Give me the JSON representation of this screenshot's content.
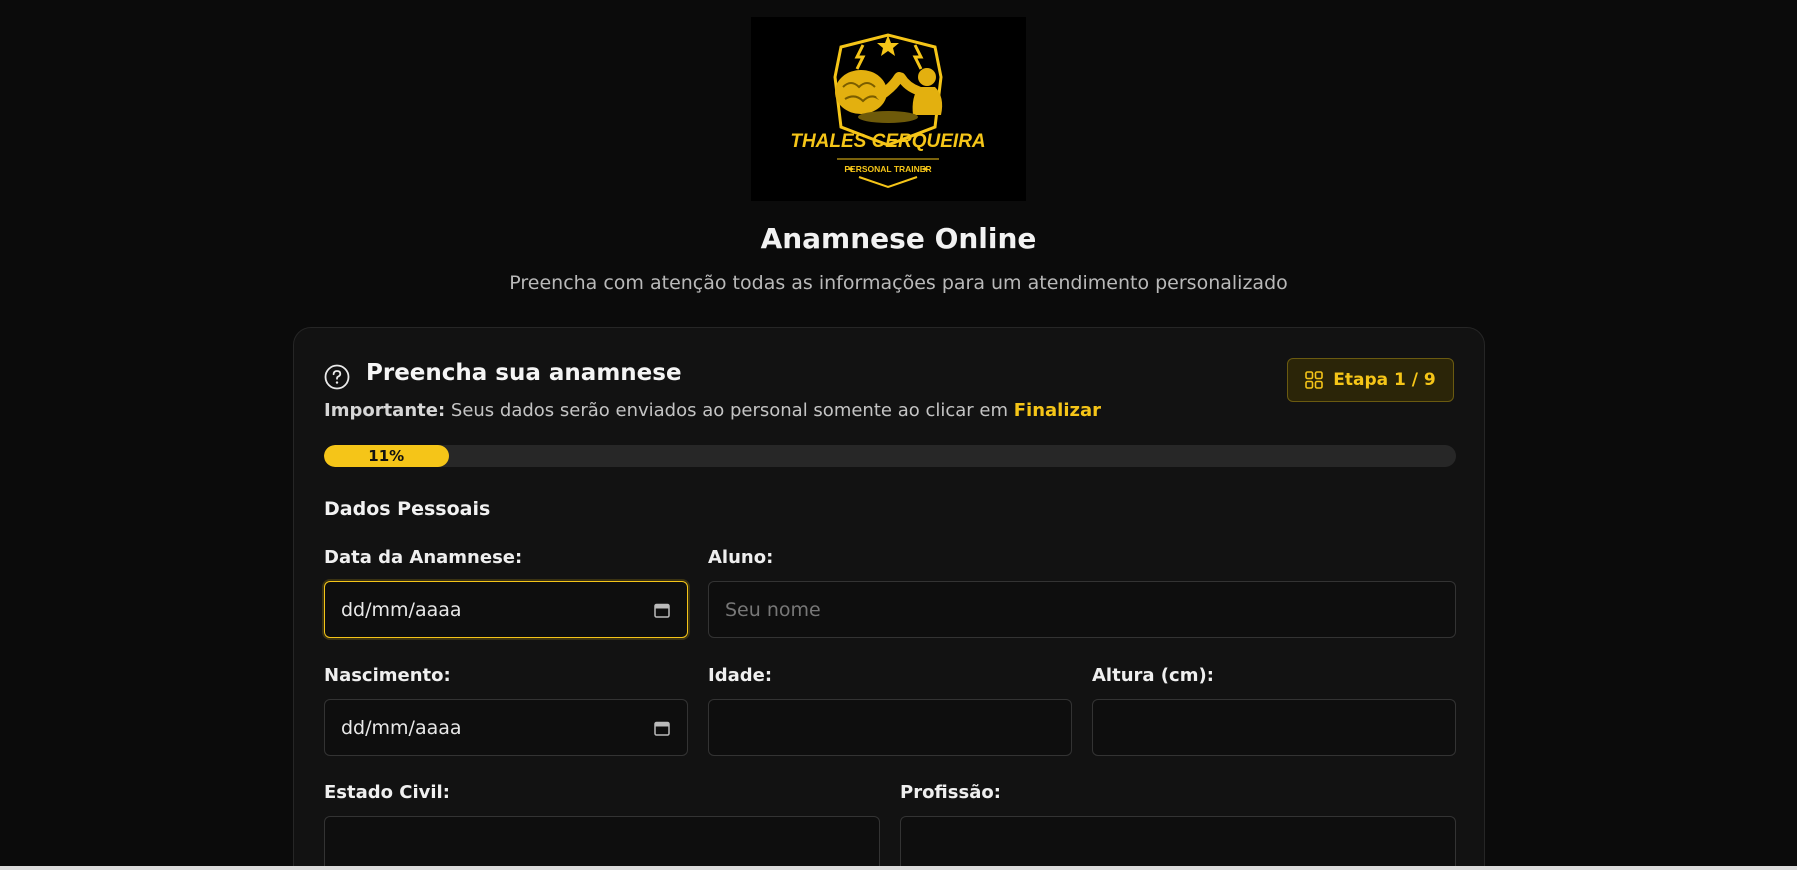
{
  "logo": {
    "brand_name": "THALES CERQUEIRA",
    "brand_tagline": "PERSONAL TRAINER",
    "accent_color": "#f5c518",
    "icon": "brain-armwrestling-logo"
  },
  "header": {
    "title": "Anamnese Online",
    "subtitle": "Preencha com atenção todas as informações para um atendimento personalizado"
  },
  "card": {
    "icon": "help-circle-icon",
    "title": "Preencha sua anamnese",
    "notice_prefix": "Importante:",
    "notice_text": " Seus dados serão enviados ao personal somente ao clicar em ",
    "notice_action": "Finalizar",
    "step_badge": {
      "icon": "grid-icon",
      "label": "Etapa 1 / 9"
    },
    "progress": {
      "value_percent": 11,
      "label": "11%"
    }
  },
  "section": {
    "title": "Dados Pessoais"
  },
  "fields": {
    "data_anamnese": {
      "label": "Data da Anamnese:",
      "value": "dd/mm/aaaa"
    },
    "aluno": {
      "label": "Aluno:",
      "placeholder": "Seu nome"
    },
    "nascimento": {
      "label": "Nascimento:",
      "value": "dd/mm/aaaa"
    },
    "idade": {
      "label": "Idade:"
    },
    "altura": {
      "label": "Altura (cm):"
    },
    "estado_civil": {
      "label": "Estado Civil:"
    },
    "profissao": {
      "label": "Profissão:"
    }
  },
  "colors": {
    "background": "#0b0b0b",
    "card": "#121212",
    "accent": "#f5c518"
  }
}
